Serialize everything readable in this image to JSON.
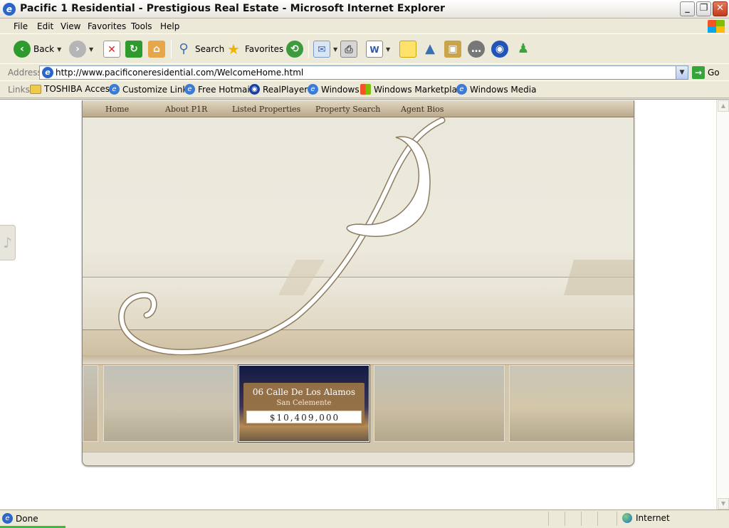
{
  "window": {
    "title": "Pacific 1 Residential - Prestigious Real Estate - Microsoft Internet Explorer"
  },
  "menu": [
    "File",
    "Edit",
    "View",
    "Favorites",
    "Tools",
    "Help"
  ],
  "toolbar": {
    "back": "Back",
    "search": "Search",
    "favorites": "Favorites"
  },
  "address": {
    "label": "Address",
    "url": "http://www.pacificoneresidential.com/WelcomeHome.html",
    "go": "Go"
  },
  "links": {
    "label": "Links",
    "items": [
      "TOSHIBA Access",
      "Customize Links",
      "Free Hotmail",
      "RealPlayer",
      "Windows",
      "Windows Marketplace",
      "Windows Media"
    ]
  },
  "site": {
    "nav": [
      "Home",
      "About P1R",
      "Listed Properties",
      "Property Search",
      "Agent Bios"
    ],
    "featured": {
      "address": "06 Calle De Los Alamos",
      "city": "San Celemente",
      "price": "$10,409,000"
    }
  },
  "status": {
    "text": "Done",
    "zone": "Internet",
    "progress": 0.09
  },
  "colors": {
    "nav_bg": "#b9a98d",
    "hero_bg": "#eae8dc",
    "accent": "#8d7b5e"
  }
}
